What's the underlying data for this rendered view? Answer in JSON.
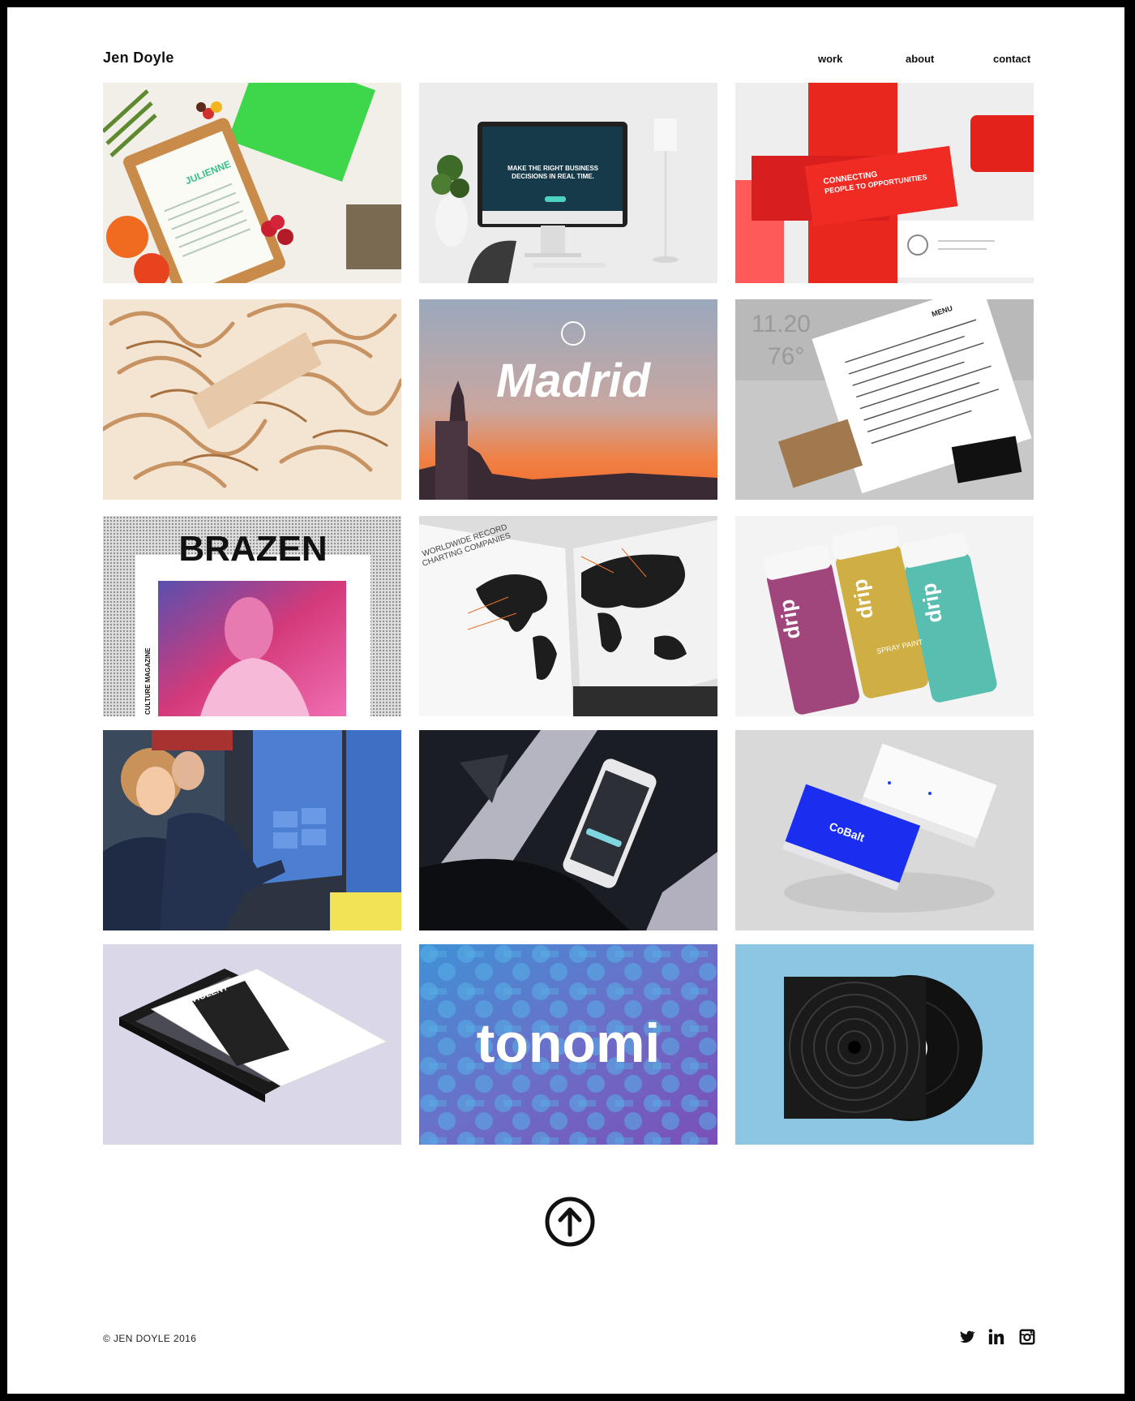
{
  "header": {
    "logo": "Jen Doyle",
    "nav": {
      "work": "work",
      "about": "about",
      "contact": "contact"
    }
  },
  "portfolio": {
    "tiles": [
      {
        "icon": "restaurant-menu-clipboard-photo",
        "label": "JULIENNE",
        "sublabel": ""
      },
      {
        "icon": "imac-website-photo",
        "label": "MAKE THE RIGHT BUSINESS",
        "sublabel": "DECISIONS IN REAL TIME."
      },
      {
        "icon": "red-brochure-photo",
        "label": "CONNECTING",
        "sublabel": "PEOPLE TO OPPORTUNITIES"
      },
      {
        "icon": "paper-shavings-photo",
        "label": "",
        "sublabel": ""
      },
      {
        "icon": "madrid-sunset-photo",
        "label": "Madrid",
        "sublabel": ""
      },
      {
        "icon": "coffee-menu-stationery-photo",
        "label": "MENU",
        "sublabel": ""
      },
      {
        "icon": "brazen-magazine-photo",
        "label": "BRAZEN",
        "sublabel": "CULTURE MAGAZINE"
      },
      {
        "icon": "world-map-book-photo",
        "label": "WORLDWIDE RECORD",
        "sublabel": "CHARTING COMPANIES"
      },
      {
        "icon": "spray-paint-cans-photo",
        "label": "drip",
        "sublabel": "SPRAY PAINT"
      },
      {
        "icon": "touchscreen-event-photo",
        "label": "",
        "sublabel": ""
      },
      {
        "icon": "smartphone-app-photo",
        "label": "",
        "sublabel": ""
      },
      {
        "icon": "business-cards-photo",
        "label": "CoBalt",
        "sublabel": ""
      },
      {
        "icon": "tablet-magazine-photo",
        "label": "VIOLENT",
        "sublabel": ""
      },
      {
        "icon": "tonomi-logo-photo",
        "label": "tonomi",
        "sublabel": ""
      },
      {
        "icon": "vinyl-record-photo",
        "label": "",
        "sublabel": ""
      }
    ]
  },
  "back_to_top": {
    "icon": "arrow-up-circle-icon"
  },
  "footer": {
    "copyright": "© JEN DOYLE 2016",
    "social": [
      "twitter-icon",
      "linkedin-icon",
      "instagram-icon"
    ]
  },
  "colors": {
    "frame": "#000000",
    "page_bg": "#ffffff",
    "text": "#111111"
  }
}
